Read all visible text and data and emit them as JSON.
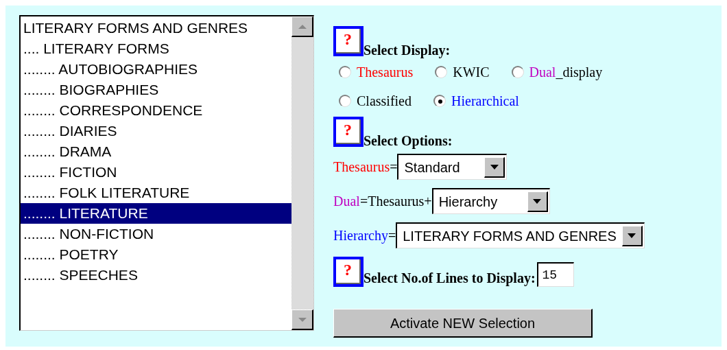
{
  "hierarchy_list": {
    "items": [
      {
        "label": "LITERARY FORMS AND GENRES",
        "selected": false
      },
      {
        "label": ".... LITERARY FORMS",
        "selected": false
      },
      {
        "label": "........ AUTOBIOGRAPHIES",
        "selected": false
      },
      {
        "label": "........ BIOGRAPHIES",
        "selected": false
      },
      {
        "label": "........ CORRESPONDENCE",
        "selected": false
      },
      {
        "label": "........ DIARIES",
        "selected": false
      },
      {
        "label": "........ DRAMA",
        "selected": false
      },
      {
        "label": "........ FICTION",
        "selected": false
      },
      {
        "label": "........ FOLK LITERATURE",
        "selected": false
      },
      {
        "label": "........ LITERATURE",
        "selected": true
      },
      {
        "label": "........ NON-FICTION",
        "selected": false
      },
      {
        "label": "........ POETRY",
        "selected": false
      },
      {
        "label": "........ SPEECHES",
        "selected": false
      }
    ]
  },
  "display": {
    "heading": "Select Display:",
    "help": "?",
    "options": [
      {
        "label": "Thesaurus",
        "color": "#ff0000",
        "selected": false
      },
      {
        "label": "KWIC",
        "color": "#000000",
        "selected": false
      },
      {
        "label": "Dual",
        "suffix": "_display",
        "color": "#c000c0",
        "selected": false
      },
      {
        "label": "Classified",
        "color": "#000000",
        "selected": false
      },
      {
        "label": "Hierarchical",
        "color": "#0000ff",
        "selected": true
      }
    ]
  },
  "options": {
    "heading": "Select Options:",
    "help": "?",
    "settings": [
      {
        "label": "Thesaurus",
        "color": "#ff0000",
        "connector": "=",
        "value": "Standard"
      },
      {
        "label": "Dual",
        "color": "#c000c0",
        "connector": "=Thesaurus+",
        "value": "Hierarchy"
      },
      {
        "label": "Hierarchy",
        "color": "#0000ff",
        "connector": "=",
        "value": "LITERARY FORMS AND GENRES"
      }
    ]
  },
  "lines": {
    "heading": "Select No.of Lines to Display:",
    "help": "?",
    "value": "15"
  },
  "submit_button": "Activate NEW Selection"
}
